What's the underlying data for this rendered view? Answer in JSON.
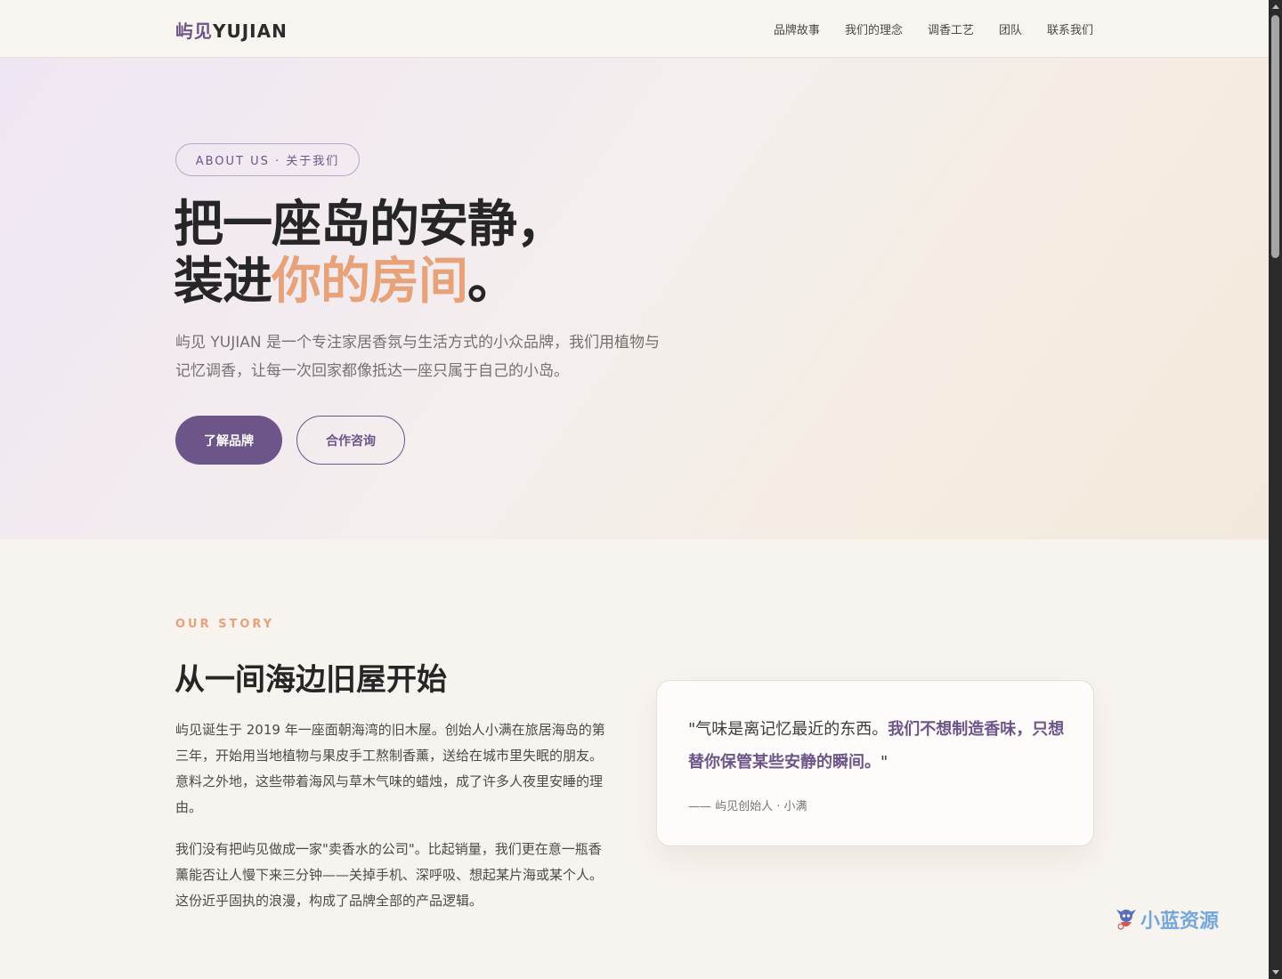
{
  "nav": {
    "logo_cn": "屿见",
    "logo_en": "YUJIAN",
    "links": [
      "品牌故事",
      "我们的理念",
      "调香工艺",
      "团队",
      "联系我们"
    ]
  },
  "hero": {
    "badge": "ABOUT US · 关于我们",
    "title_line1": "把一座岛的安静，",
    "title_line2_pre": "装进",
    "title_line2_accent": "你的房间",
    "title_line2_post": "。",
    "description": "屿见 YUJIAN 是一个专注家居香氛与生活方式的小众品牌，我们用植物与记忆调香，让每一次回家都像抵达一座只属于自己的小岛。",
    "btn_primary": "了解品牌",
    "btn_secondary": "合作咨询"
  },
  "story": {
    "eyebrow": "OUR STORY",
    "title": "从一间海边旧屋开始",
    "paragraph1": "屿见诞生于 2019 年一座面朝海湾的旧木屋。创始人小满在旅居海岛的第三年，开始用当地植物与果皮手工熬制香薰，送给在城市里失眠的朋友。意料之外地，这些带着海风与草木气味的蜡烛，成了许多人夜里安睡的理由。",
    "paragraph2": "我们没有把屿见做成一家\"卖香水的公司\"。比起销量，我们更在意一瓶香薰能否让人慢下来三分钟——关掉手机、深呼吸、想起某片海或某个人。这份近乎固执的浪漫，构成了品牌全部的产品逻辑。",
    "quote_plain": "\"气味是离记忆最近的东西。",
    "quote_strong": "我们不想制造香味，只想替你保管某些安静的瞬间。",
    "quote_end": "\"",
    "quote_author": "—— 屿见创始人 · 小满"
  },
  "watermark": {
    "text": "小蓝资源"
  },
  "colors": {
    "brand_purple": "#6e5589",
    "accent_peach": "#e7a27a",
    "background": "#f7f3ee"
  }
}
